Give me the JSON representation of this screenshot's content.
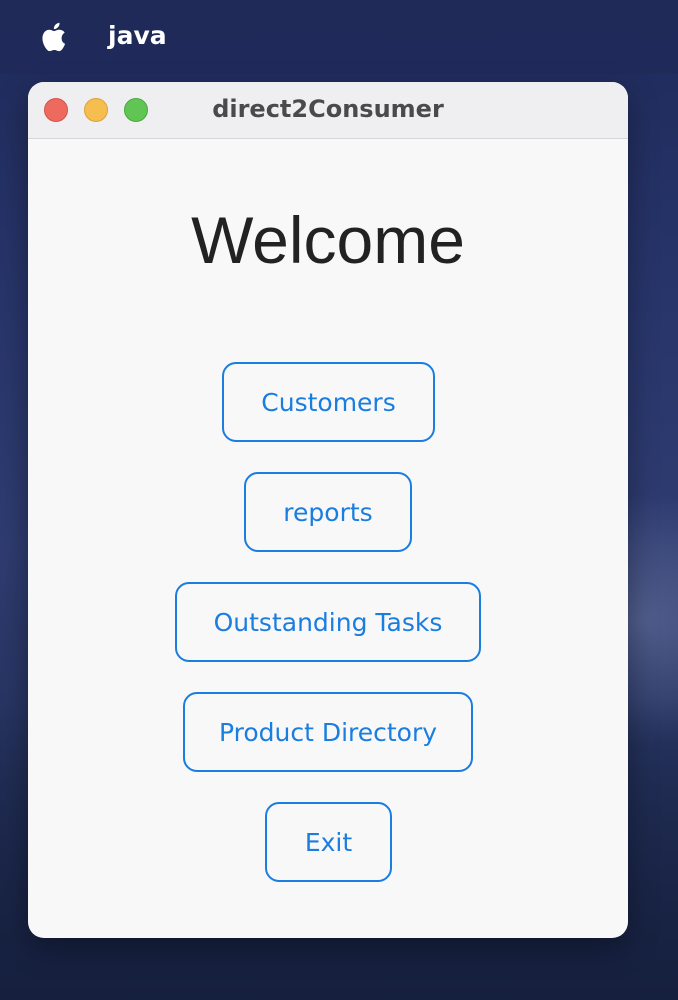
{
  "menubar": {
    "apple_icon": "apple-logo-icon",
    "app_name": "java"
  },
  "window": {
    "title": "direct2Consumer",
    "controls": [
      "close",
      "minimize",
      "maximize"
    ],
    "colors": {
      "close": "#ee6a5e",
      "minimize": "#f5be4f",
      "maximize": "#61c554"
    }
  },
  "main": {
    "heading": "Welcome",
    "buttons": [
      {
        "label": "Customers"
      },
      {
        "label": "reports"
      },
      {
        "label": "Outstanding Tasks"
      },
      {
        "label": "Product Directory"
      },
      {
        "label": "Exit"
      }
    ],
    "accent_color": "#1a7de0"
  }
}
